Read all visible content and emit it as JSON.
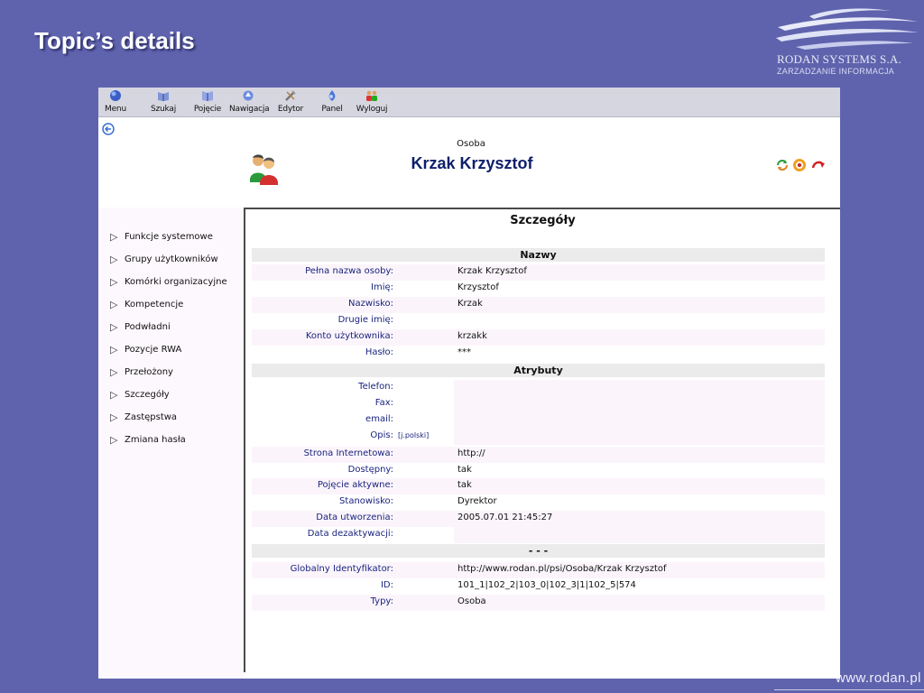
{
  "slide": {
    "title": "Topic’s details",
    "logo": {
      "name": "RODAN SYSTEMS S.A.",
      "tagline": "ZARZADZANIE INFORMACJA"
    },
    "footer_url": "www.rodan.pl"
  },
  "toolbar": [
    {
      "label": "Menu",
      "icon": "menu-icon"
    },
    {
      "label": "Szukaj",
      "icon": "search-icon"
    },
    {
      "label": "Pojęcie",
      "icon": "book-icon"
    },
    {
      "label": "Nawigacja",
      "icon": "navigation-icon"
    },
    {
      "label": "Edytor",
      "icon": "tools-icon"
    },
    {
      "label": "Panel",
      "icon": "panel-icon"
    },
    {
      "label": "Wyloguj",
      "icon": "logout-icon"
    }
  ],
  "header": {
    "type": "Osoba",
    "name": "Krzak Krzysztof",
    "actions": [
      "refresh-icon",
      "settings-icon",
      "forward-arrow-icon"
    ]
  },
  "sidebar": [
    "Funkcje systemowe",
    "Grupy użytkowników",
    "Komórki organizacyjne",
    "Kompetencje",
    "Podwładni",
    "Pozycje RWA",
    "Przełożony",
    "Szczegóły",
    "Zastępstwa",
    "Zmiana hasła"
  ],
  "details": {
    "heading": "Szczegóły",
    "sections": [
      {
        "title": "Nazwy",
        "rows": [
          {
            "label": "Pełna nazwa osoby:",
            "value": "Krzak Krzysztof"
          },
          {
            "label": "Imię:",
            "value": "Krzysztof"
          },
          {
            "label": "Nazwisko:",
            "value": "Krzak"
          },
          {
            "label": "Drugie imię:",
            "value": ""
          },
          {
            "label": "Konto użytkownika:",
            "value": "krzakk"
          },
          {
            "label": "Hasło:",
            "value": "***"
          }
        ]
      },
      {
        "title": "Atrybuty",
        "rows": [
          {
            "label": "Telefon:",
            "value": ""
          },
          {
            "label": "Fax:",
            "value": ""
          },
          {
            "label": "email:",
            "value": ""
          },
          {
            "label": "Opis:",
            "value": "",
            "link": "[j.polski]"
          },
          {
            "label": "Strona Internetowa:",
            "value": "http://"
          },
          {
            "label": "Dostępny:",
            "value": "tak"
          },
          {
            "label": "Pojęcie aktywne:",
            "value": "tak"
          },
          {
            "label": "Stanowisko:",
            "value": "Dyrektor"
          },
          {
            "label": "Data utworzenia:",
            "value": "2005.07.01 21:45:27"
          },
          {
            "label": "Data dezaktywacji:",
            "value": ""
          }
        ]
      },
      {
        "title": "- - -",
        "rows": [
          {
            "label": "Globalny Identyfikator:",
            "value": "http://www.rodan.pl/psi/Osoba/Krzak Krzysztof"
          },
          {
            "label": "ID:",
            "value": "101_1|102_2|103_0|102_3|1|102_5|574"
          },
          {
            "label": "Typy:",
            "value": "Osoba"
          }
        ]
      }
    ]
  }
}
